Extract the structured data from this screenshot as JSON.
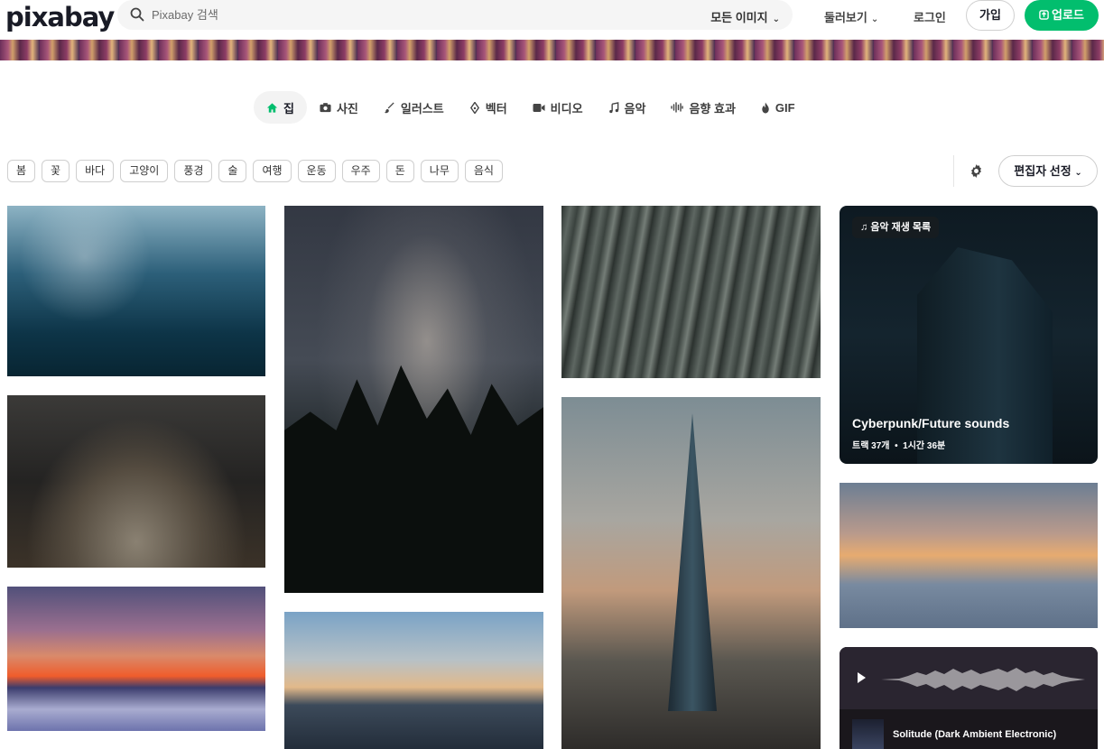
{
  "header": {
    "logo": "pixabay",
    "search_placeholder": "Pixabay 검색",
    "search_type": "모든 이미지",
    "explore": "둘러보기",
    "login": "로그인",
    "join": "가입",
    "upload": "업로드"
  },
  "tabs": [
    {
      "label": "집",
      "icon": "home-icon",
      "active": true
    },
    {
      "label": "사진",
      "icon": "camera-icon"
    },
    {
      "label": "일러스트",
      "icon": "brush-icon"
    },
    {
      "label": "벡터",
      "icon": "pen-nib-icon"
    },
    {
      "label": "비디오",
      "icon": "video-icon"
    },
    {
      "label": "음악",
      "icon": "music-note-icon"
    },
    {
      "label": "음향 효과",
      "icon": "soundwave-icon"
    },
    {
      "label": "GIF",
      "icon": "flame-icon"
    }
  ],
  "chips": [
    "봄",
    "꽃",
    "바다",
    "고양이",
    "풍경",
    "술",
    "여행",
    "운동",
    "우주",
    "돈",
    "나무",
    "음식"
  ],
  "sort": "편집자 선정",
  "playlist": {
    "badge": "음악 재생 목록",
    "title": "Cyberpunk/Future sounds",
    "tracks": "트랙 37개",
    "duration": "1시간 36분"
  },
  "track": {
    "title": "Solitude (Dark Ambient Electronic)"
  },
  "colors": {
    "accent": "#02be6e",
    "text": "#191b26"
  }
}
